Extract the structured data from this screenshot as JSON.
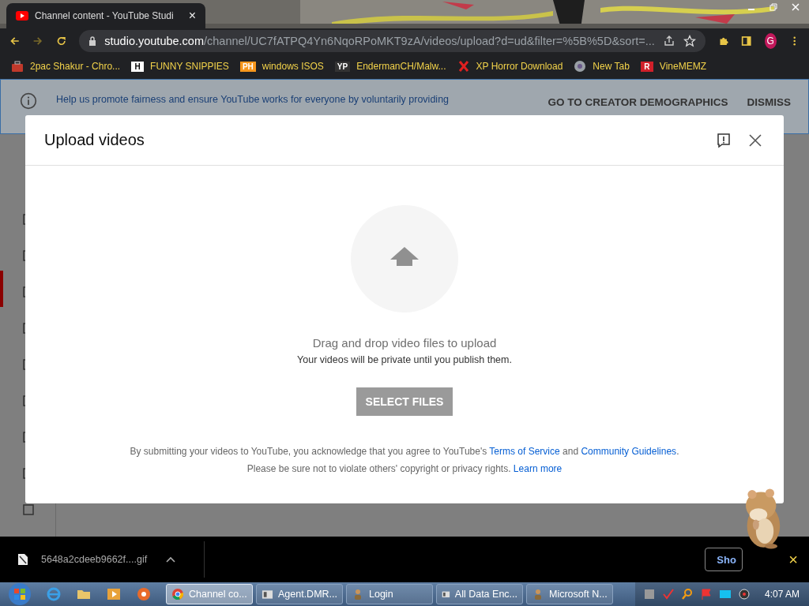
{
  "browser": {
    "tab": {
      "title": "Channel content - YouTube Studi",
      "close": "×"
    },
    "address": {
      "domain": "studio.youtube.com",
      "path": "/channel/UC7fATPQ4Yn6NqoRPoMKT9zA/videos/upload?d=ud&filter=%5B%5D&sort=..."
    },
    "avatar": "G",
    "bookmarks": [
      {
        "label": "2pac Shakur - Chro...",
        "kind": "bag",
        "color": "#c0392b"
      },
      {
        "label": "FUNNY SNIPPIES",
        "kind": "letter",
        "badge": "H",
        "color": "#ffffff"
      },
      {
        "label": "windows ISOS",
        "kind": "letter",
        "badge": "PH",
        "color": "#f7971d"
      },
      {
        "label": "EndermanCH/Malw...",
        "kind": "letter",
        "badge": "YP",
        "color": "#333333"
      },
      {
        "label": "XP Horror Download",
        "kind": "x",
        "color": "#e02020"
      },
      {
        "label": "New Tab",
        "kind": "globe",
        "color": "#9aa0a6"
      },
      {
        "label": "VineMEMZ",
        "kind": "letter",
        "badge": "R",
        "color": "#d0202a"
      }
    ]
  },
  "banner": {
    "text": "Help us promote fairness and ensure YouTube works for everyone by voluntarily providing",
    "actions": [
      "GO TO CREATOR DEMOGRAPHICS",
      "DISMISS"
    ]
  },
  "dialog": {
    "title": "Upload videos",
    "heading": "Drag and drop video files to upload",
    "subtext": "Your videos will be private until you publish them.",
    "button": {
      "label": "SELECT FILES",
      "disabled": true
    },
    "legal": [
      [
        {
          "kind": "text",
          "text": "By submitting your videos to YouTube, you acknowledge that you agree to YouTube's "
        },
        {
          "kind": "link",
          "text": "Terms of Service"
        },
        {
          "kind": "text",
          "text": " and "
        },
        {
          "kind": "link",
          "text": "Community Guidelines"
        },
        {
          "kind": "text",
          "text": "."
        }
      ],
      [
        {
          "kind": "text",
          "text": "Please be sure not to violate others' copyright or privacy rights. "
        },
        {
          "kind": "link",
          "text": "Learn more"
        }
      ]
    ]
  },
  "download": {
    "filename": "5648a2cdeeb9662f....gif",
    "show_button": "Sho",
    "close": "×"
  },
  "taskbar": {
    "tasks": [
      {
        "label": "Channel co...",
        "selected": true,
        "kind": "chrome"
      },
      {
        "label": "Agent.DMR...",
        "selected": false,
        "kind": "window"
      },
      {
        "label": "Login",
        "selected": false,
        "kind": "figure"
      },
      {
        "label": "All Data Enc...",
        "selected": false,
        "kind": "window"
      },
      {
        "label": "Microsoft N...",
        "selected": false,
        "kind": "figure"
      }
    ],
    "clock": "4:07 AM"
  }
}
